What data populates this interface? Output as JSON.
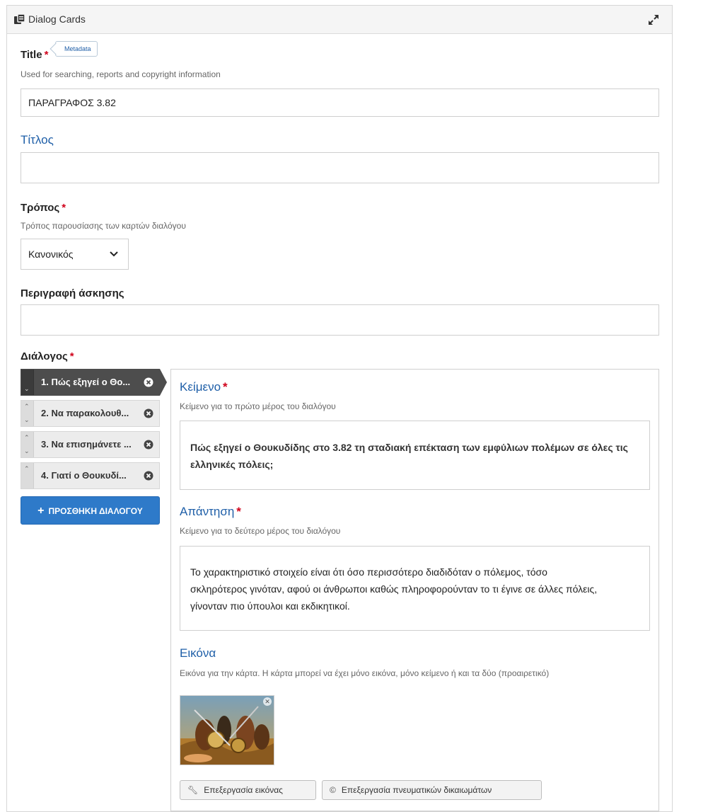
{
  "header": {
    "title": "Dialog Cards"
  },
  "title_field": {
    "label": "Title",
    "required_mark": "*",
    "metadata_tag": "Metadata",
    "description": "Used for searching, reports and copyright information",
    "value": "ΠΑΡΑΓΡΑΦΟΣ 3.82"
  },
  "titlos_field": {
    "label": "Τίτλος",
    "value": ""
  },
  "mode_field": {
    "label": "Τρόπος",
    "required_mark": "*",
    "description": "Τρόπος παρουσίασης των καρτών διαλόγου",
    "selected": "Κανονικός"
  },
  "description_field": {
    "label": "Περιγραφή άσκησης",
    "value": ""
  },
  "dialogs": {
    "label": "Διάλογος",
    "required_mark": "*",
    "items": [
      {
        "label": "1. Πώς εξηγεί ο Θο...",
        "active": true
      },
      {
        "label": "2. Να παρακολουθ..."
      },
      {
        "label": "3. Να επισημάνετε ..."
      },
      {
        "label": "4. Γιατί ο Θουκυδί..."
      }
    ],
    "add_button": "ΠΡΟΣΘΗΚΗ ΔΙΑΛΟΓΟΥ",
    "text_field": {
      "label": "Κείμενο",
      "required_mark": "*",
      "description": "Κείμενο για το πρώτο μέρος του διαλόγου",
      "value": "Πώς εξηγεί ο Θουκυδίδης στο 3.82 τη σταδιακή επέκταση των εμφύλιων πολέμων σε όλες τις ελληνικές πόλεις;"
    },
    "answer_field": {
      "label": "Απάντηση",
      "required_mark": "*",
      "description": "Κείμενο για το δεύτερο μέρος του διαλόγου",
      "value": "Το χαρακτηριστικό στοιχείο είναι ότι όσο περισσότερο διαδιδόταν ο πόλεμος, τόσο σκληρότερος γινόταν, αφού οι άνθρωποι καθώς πληροφορούνταν το τι έγινε σε άλλες πόλεις, γίνονταν πιο ύπουλοι και εκδικητικοί."
    },
    "image_field": {
      "label": "Εικόνα",
      "description": "Εικόνα για την κάρτα. Η κάρτα μπορεί να έχει μόνο εικόνα, μόνο κείμενο ή και τα δύο (προαιρετικό)",
      "edit_image_button": "Επεξεργασία εικόνας",
      "edit_copyright_button": "Επεξεργασία πνευματικών δικαιωμάτων"
    }
  },
  "colors": {
    "accent": "#2e7ac9",
    "label_blue": "#1f5fa8",
    "required": "#d0021b",
    "active_tab": "#4d4d4d"
  },
  "icons": {
    "header": "dialog-cards-icon",
    "expand": "expand-icon",
    "remove": "remove-circle-icon",
    "wrench": "wrench-icon",
    "copyright": "copyright-icon"
  }
}
